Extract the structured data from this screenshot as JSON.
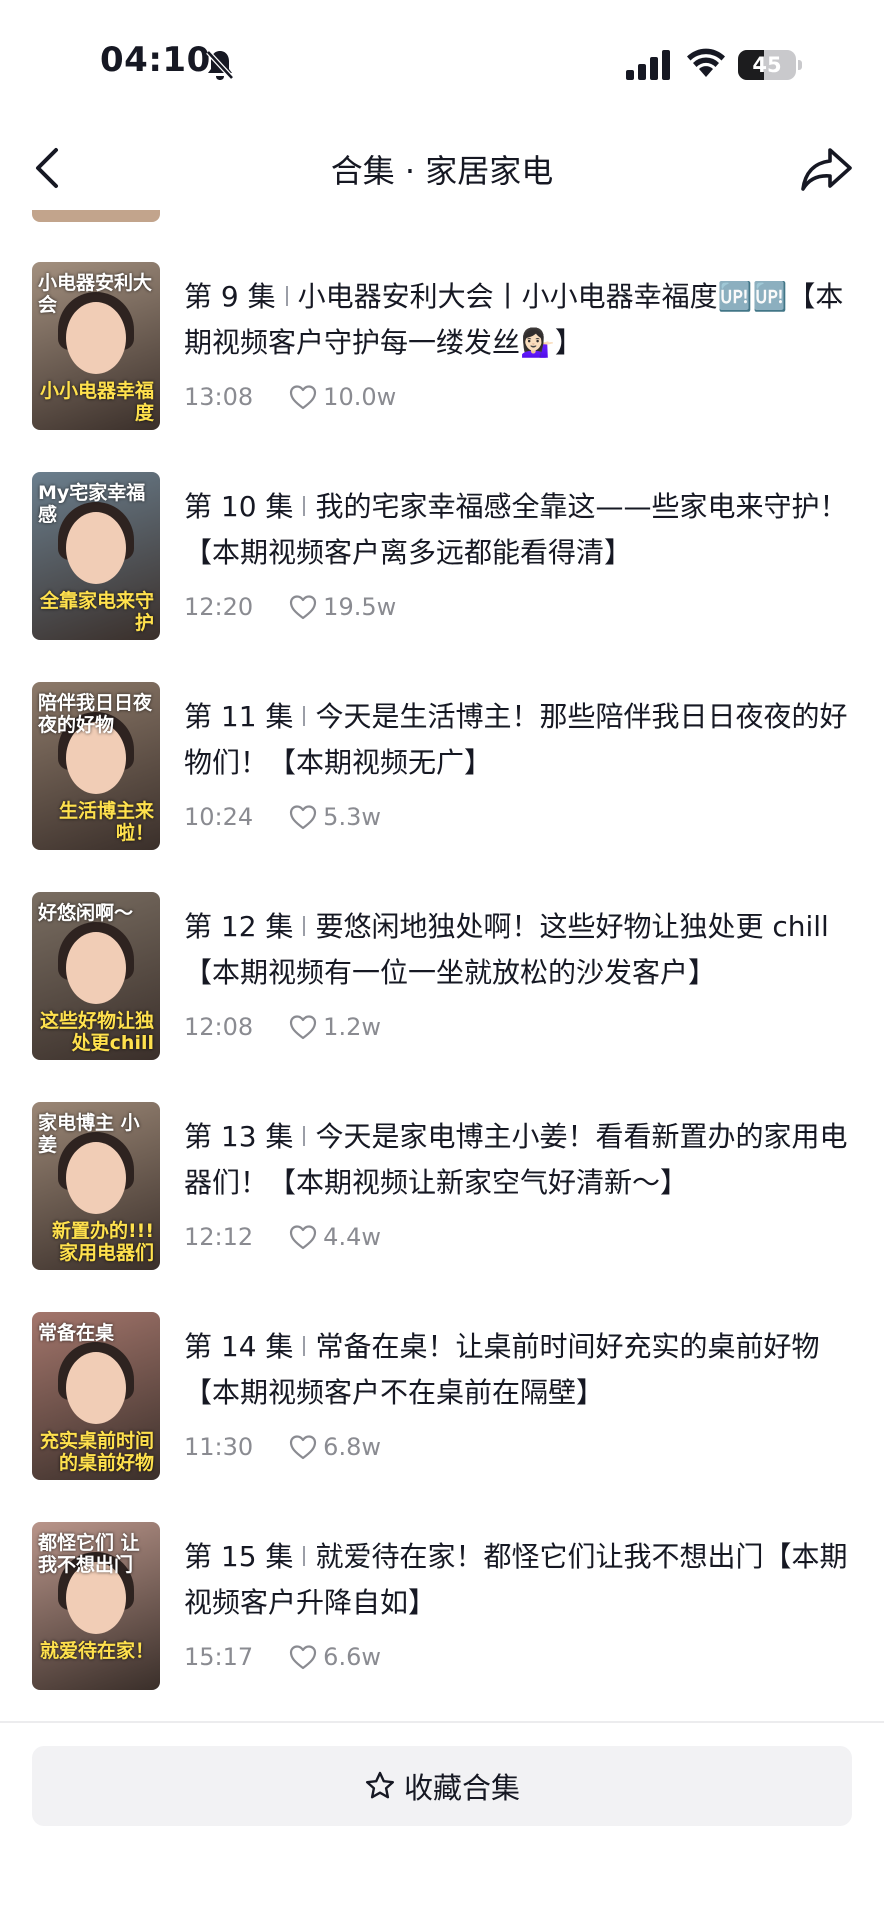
{
  "status_bar": {
    "time": "04:10",
    "battery": "45",
    "battery_level": 0.45
  },
  "header": {
    "title": "合集 · 家居家电"
  },
  "episodes": [
    {
      "ep": "第 9 集",
      "title": "小电器安利大会丨小小电器幸福度🆙🆙【本期视频客户守护每一缕发丝💁🏻‍♀️】",
      "duration": "13:08",
      "likes": "10.0w",
      "thumb_top": "小电器安利大会",
      "thumb_bottom": "小小电器幸福度",
      "thumb_bg": "#a3907f"
    },
    {
      "ep": "第 10 集",
      "title": "我的宅家幸福感全靠这——些家电来守护！【本期视频客户离多远都能看得清】",
      "duration": "12:20",
      "likes": "19.5w",
      "thumb_top": "My宅家幸福感",
      "thumb_bottom": "全靠家电来守护",
      "thumb_bg": "#6b7f8e"
    },
    {
      "ep": "第 11 集",
      "title": "今天是生活博主！那些陪伴我日日夜夜的好物们！【本期视频无广】",
      "duration": "10:24",
      "likes": "5.3w",
      "thumb_top": "陪伴我日日夜夜的好物",
      "thumb_bottom": "生活博主来啦！",
      "thumb_bg": "#8d7a6a"
    },
    {
      "ep": "第 12 集",
      "title": "要悠闲地独处啊！这些好物让独处更 chill【本期视频有一位一坐就放松的沙发客户】",
      "duration": "12:08",
      "likes": "1.2w",
      "thumb_top": "好悠闲啊～",
      "thumb_bottom": "这些好物让独处更chill",
      "thumb_bg": "#7a6e62"
    },
    {
      "ep": "第 13 集",
      "title": "今天是家电博主小姜！看看新置办的家用电器们！【本期视频让新家空气好清新～】",
      "duration": "12:12",
      "likes": "4.4w",
      "thumb_top": "家电博主 小姜",
      "thumb_bottom": "新置办的!!! 家用电器们",
      "thumb_bg": "#9b8776"
    },
    {
      "ep": "第 14 集",
      "title": "常备在桌！让桌前时间好充实的桌前好物【本期视频客户不在桌前在隔壁】",
      "duration": "11:30",
      "likes": "6.8w",
      "thumb_top": "常备在桌",
      "thumb_bottom": "充实桌前时间的桌前好物",
      "thumb_bg": "#a4766c"
    },
    {
      "ep": "第 15 集",
      "title": "就爱待在家！都怪它们让我不想出门【本期视频客户升降自如】",
      "duration": "15:17",
      "likes": "6.6w",
      "thumb_top": "都怪它们 让我不想出门",
      "thumb_bottom": "就爱待在家！",
      "thumb_bg": "#b9958a"
    }
  ],
  "footer": {
    "collect_label": "收藏合集"
  },
  "colors": {
    "text_primary": "#161823",
    "text_secondary": "#8a8b91",
    "button_bg": "#f2f2f4"
  }
}
